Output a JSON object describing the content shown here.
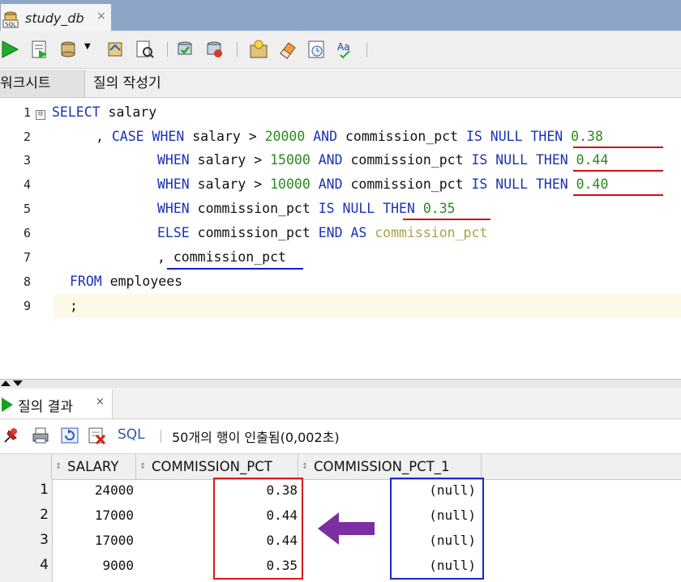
{
  "window": {
    "tab_title": "study_db",
    "tab_close": "×",
    "tab_badge": "SQL"
  },
  "toolbar": {
    "icons": [
      "run-statement",
      "run-script",
      "commit",
      "rollback",
      "explain-plan",
      "autotrace",
      "sql-tuning",
      "unshared-sql",
      "clear",
      "history",
      "format"
    ]
  },
  "subtabs": {
    "worksheet": "워크시트",
    "query_builder": "질의 작성기"
  },
  "editor": {
    "line_numbers": [
      "1",
      "2",
      "3",
      "4",
      "5",
      "6",
      "7",
      "8",
      "9"
    ],
    "fold_marker": "⊟",
    "lines": [
      [
        "SELECT",
        " salary"
      ],
      [
        ", ",
        "CASE WHEN",
        " salary > ",
        "20000",
        " ",
        "AND",
        " commission_pct ",
        "IS NULL",
        " ",
        "THEN",
        " ",
        "0.38"
      ],
      [
        "WHEN",
        " salary > ",
        "15000",
        " ",
        "AND",
        " commission_pct ",
        "IS NULL",
        " ",
        "THEN",
        " ",
        "0.44"
      ],
      [
        "WHEN",
        " salary > ",
        "10000",
        " ",
        "AND",
        " commission_pct ",
        "IS NULL",
        " ",
        "THEN",
        " ",
        "0.40"
      ],
      [
        "WHEN",
        " commission_pct ",
        "IS NULL",
        " ",
        "THEN",
        " ",
        "0.35"
      ],
      [
        "ELSE",
        " commission_pct ",
        "END AS",
        " ",
        "commission_pct"
      ],
      [
        ", commission_pct"
      ],
      [
        "FROM",
        " employees"
      ],
      [
        ";"
      ]
    ]
  },
  "results": {
    "tab_label": "질의 결과",
    "tab_close": "×",
    "sql_link": "SQL",
    "status": "50개의 행이 인출됨(0,002초)",
    "columns": [
      "SALARY",
      "COMMISSION_PCT",
      "COMMISSION_PCT_1"
    ],
    "rows": [
      {
        "n": "1",
        "salary": "24000",
        "pct": "0.38",
        "pct1": "(null)"
      },
      {
        "n": "2",
        "salary": "17000",
        "pct": "0.44",
        "pct1": "(null)"
      },
      {
        "n": "3",
        "salary": "17000",
        "pct": "0.44",
        "pct1": "(null)"
      },
      {
        "n": "4",
        "salary": "9000",
        "pct": "0.35",
        "pct1": "(null)"
      }
    ],
    "row_icons": [
      "pin-icon",
      "print-icon",
      "refresh-icon",
      "delete-icon"
    ]
  },
  "annotations": {
    "red_color": "#d41a1a",
    "blue_color": "#1a25cf",
    "arrow_color": "#7b2fa0"
  }
}
